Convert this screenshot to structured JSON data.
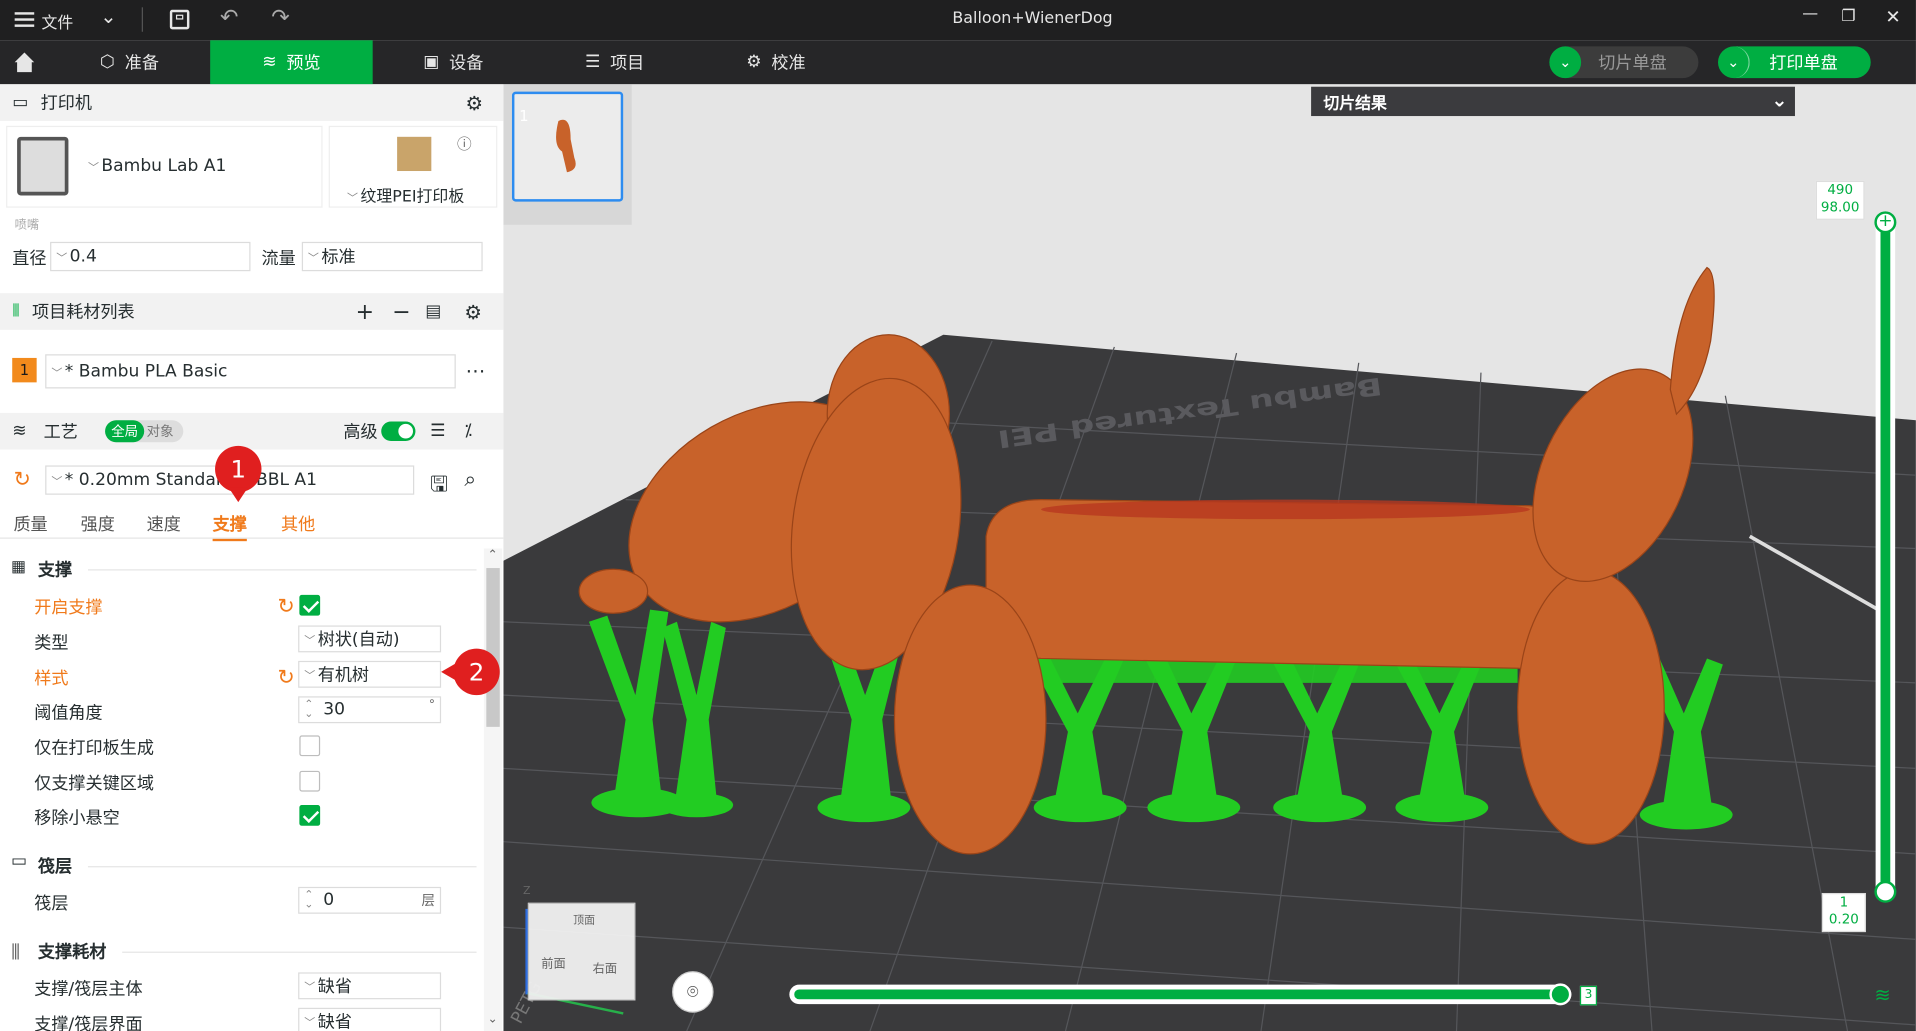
{
  "window": {
    "title": "Balloon+WienerDog",
    "menu_label": "文件"
  },
  "nav": {
    "tabs": [
      {
        "label": "准备"
      },
      {
        "label": "预览"
      },
      {
        "label": "设备"
      },
      {
        "label": "项目"
      },
      {
        "label": "校准"
      }
    ],
    "slice_button": "切片单盘",
    "print_button": "打印单盘"
  },
  "printer": {
    "section_title": "打印机",
    "model": "Bambu Lab A1",
    "plate": "纹理PEI打印板",
    "nozzle_group": "喷嘴",
    "diameter_label": "直径",
    "diameter_value": "0.4",
    "flow_label": "流量",
    "flow_value": "标准"
  },
  "filaments": {
    "section_title": "项目耗材列表",
    "items": [
      {
        "index": "1",
        "name": "* Bambu PLA Basic",
        "color": "#f28a1c"
      }
    ]
  },
  "process": {
    "section_title": "工艺",
    "toggle_global": "全局",
    "toggle_object": "对象",
    "advanced_label": "高级",
    "preset": "* 0.20mm Standard @BBL A1",
    "tabs": [
      "质量",
      "强度",
      "速度",
      "支撑",
      "其他"
    ],
    "active_tab": "支撑"
  },
  "support": {
    "group_title": "支撑",
    "rows": [
      {
        "label": "开启支撑",
        "checked": true
      },
      {
        "label": "类型",
        "value": "树状(自动)"
      },
      {
        "label": "样式",
        "value": "有机树"
      },
      {
        "label": "阈值角度",
        "value": "30",
        "unit": "°"
      },
      {
        "label": "仅在打印板生成",
        "checked": false
      },
      {
        "label": "仅支撑关键区域",
        "checked": false
      },
      {
        "label": "移除小悬空",
        "checked": true
      }
    ]
  },
  "raft": {
    "group_title": "筏层",
    "label": "筏层",
    "value": "0",
    "unit": "层"
  },
  "support_filament": {
    "group_title": "支撑耗材",
    "rows": [
      {
        "label": "支撑/筏层主体",
        "value": "缺省"
      },
      {
        "label": "支撑/筏层界面",
        "value": "缺省"
      }
    ]
  },
  "annotations": [
    "1",
    "2"
  ],
  "viewport": {
    "plate_number": "1",
    "slice_result": "切片结果",
    "bed_text": "Bambu Textured PEI",
    "bed_corner_text": "PETG",
    "layer_top": "490",
    "layer_top_height": "98.00",
    "layer_bottom": "1",
    "layer_bottom_height": "0.20",
    "horizontal_value": "3",
    "cube_top": "顶面",
    "cube_front": "前面",
    "cube_right": "右面",
    "axis_z": "Z"
  },
  "colors": {
    "accent": "#00ae42",
    "orange": "#f07a1b",
    "model": "#c8622a",
    "support": "#22cc22",
    "bed": "#3a3a3c"
  }
}
